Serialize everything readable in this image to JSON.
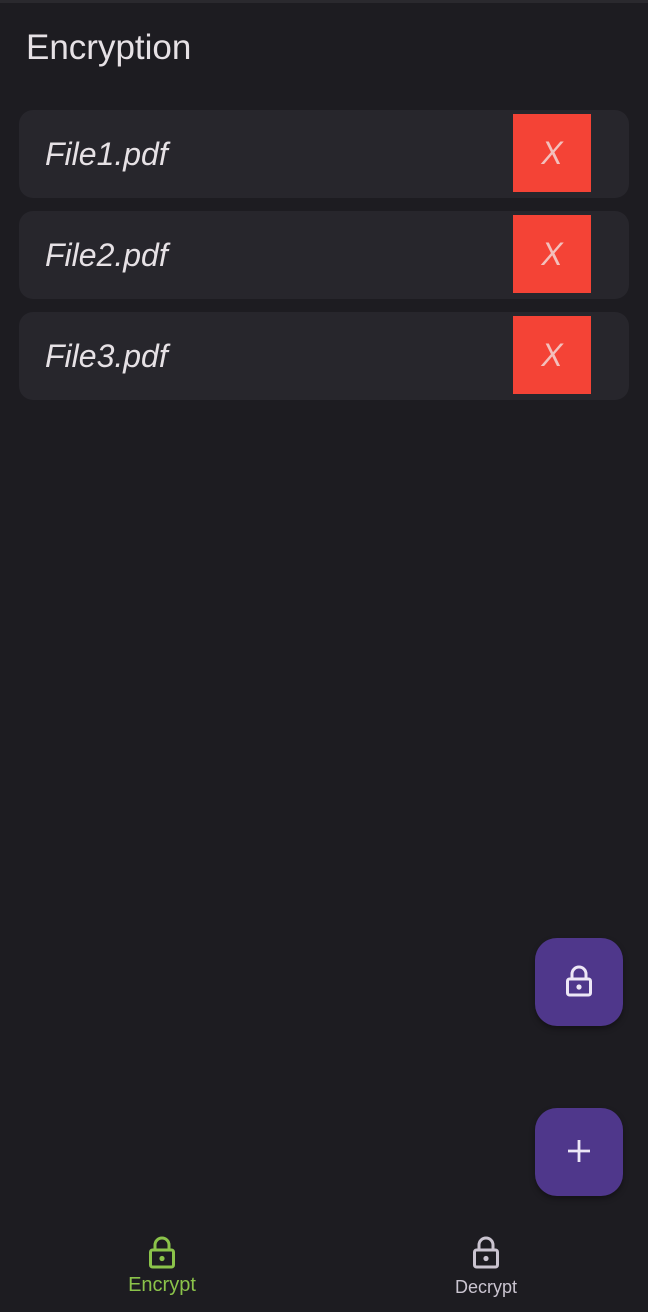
{
  "header": {
    "title": "Encryption"
  },
  "files": [
    {
      "name": "File1.pdf",
      "remove_label": "X"
    },
    {
      "name": "File2.pdf",
      "remove_label": "X"
    },
    {
      "name": "File3.pdf",
      "remove_label": "X"
    }
  ],
  "fabs": {
    "encrypt_icon": "lock-icon",
    "add_icon": "plus-icon"
  },
  "bottom_nav": {
    "items": [
      {
        "label": "Encrypt",
        "icon": "lock-icon",
        "active": true
      },
      {
        "label": "Decrypt",
        "icon": "lock-icon",
        "active": false
      }
    ]
  },
  "colors": {
    "background": "#1d1c21",
    "card": "#27262c",
    "remove_button": "#f44336",
    "fab": "#4f378b",
    "active_nav": "#8bc34a",
    "inactive_nav": "#cac4d0"
  }
}
